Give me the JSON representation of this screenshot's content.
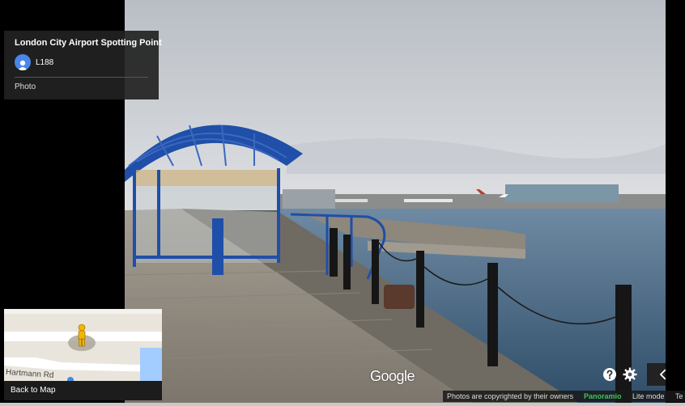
{
  "info_card": {
    "title": "London City Airport Spotting Point",
    "user": "L188",
    "type": "Photo"
  },
  "minimap": {
    "road_label": "Hartmann Rd",
    "back_label": "Back to Map"
  },
  "branding": {
    "logo_text": "Google"
  },
  "footer": {
    "copyright": "Photos are copyrighted by their owners",
    "panoramio": "Panoramio",
    "lite_mode": "Lite mode",
    "truncated": "Te"
  },
  "icons": {
    "help": "help-icon",
    "settings": "gear-icon",
    "collapse": "chevron-left-icon",
    "pegman": "pegman-icon",
    "avatar": "user-avatar-icon"
  },
  "colors": {
    "accent_blue": "#4a86e8",
    "pegman_yellow": "#f5b400",
    "panoramio_green": "#3fc35d",
    "shelter_blue": "#1f4fa8",
    "water": "#3c5f7e"
  }
}
